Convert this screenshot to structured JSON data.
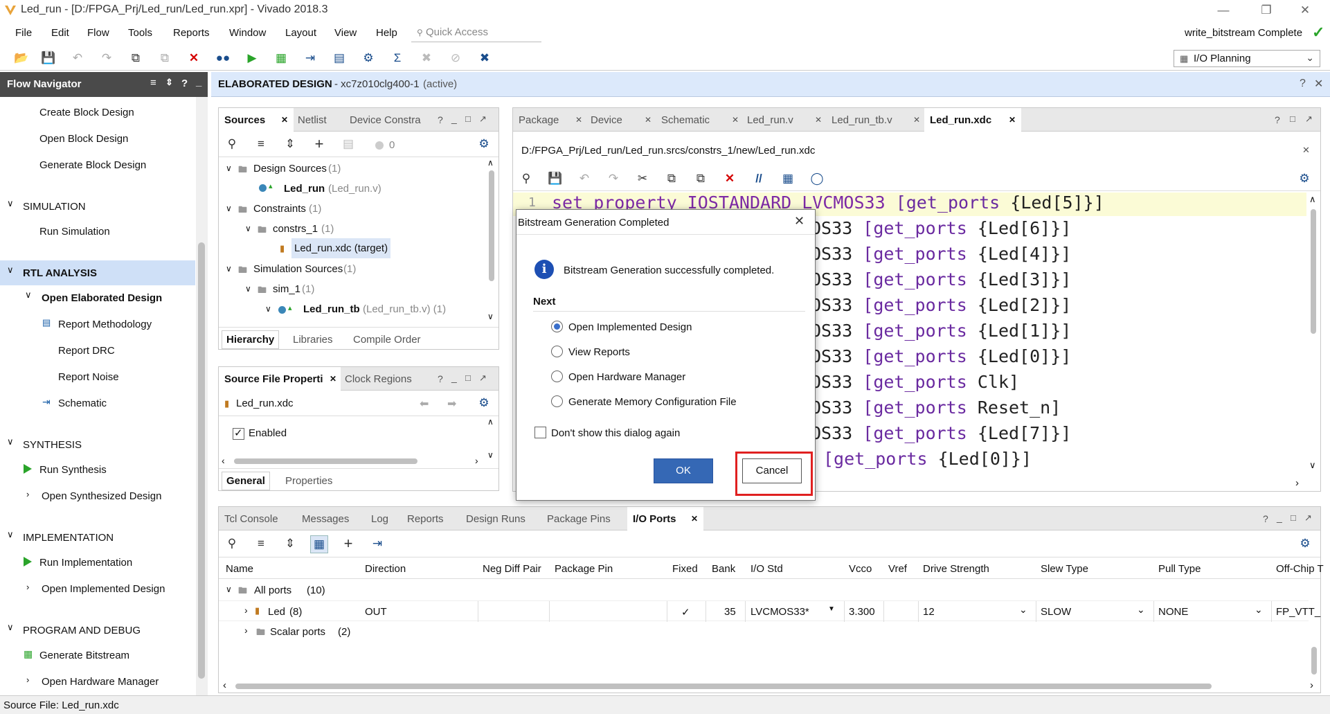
{
  "window": {
    "title": "Led_run - [D:/FPGA_Prj/Led_run/Led_run.xpr] - Vivado 2018.3",
    "status_right": "write_bitstream Complete"
  },
  "menu": [
    "File",
    "Edit",
    "Flow",
    "Tools",
    "Reports",
    "Window",
    "Layout",
    "View",
    "Help"
  ],
  "quick_access": {
    "placeholder": "Quick Access"
  },
  "layout_selector": {
    "value": "I/O Planning"
  },
  "flow_navigator": {
    "title": "Flow Navigator",
    "items": {
      "create_block": "Create Block Design",
      "open_block": "Open Block Design",
      "gen_block": "Generate Block Design",
      "simulation": "SIMULATION",
      "run_sim": "Run Simulation",
      "rtl": "RTL ANALYSIS",
      "open_elab": "Open Elaborated Design",
      "report_meth": "Report Methodology",
      "report_drc": "Report DRC",
      "report_noise": "Report Noise",
      "schematic": "Schematic",
      "synthesis": "SYNTHESIS",
      "run_synth": "Run Synthesis",
      "open_synth": "Open Synthesized Design",
      "implementation": "IMPLEMENTATION",
      "run_impl": "Run Implementation",
      "open_impl": "Open Implemented Design",
      "prog": "PROGRAM AND DEBUG",
      "gen_bit": "Generate Bitstream",
      "open_hw": "Open Hardware Manager"
    }
  },
  "design_header": {
    "title": "ELABORATED DESIGN",
    "part": "- xc7z010clg400-1",
    "state": "(active)"
  },
  "sources": {
    "tabs": [
      "Sources",
      "Netlist",
      "Device Constra"
    ],
    "count": "0",
    "tree": {
      "design_sources": "Design Sources",
      "design_sources_n": "(1)",
      "led_run": "Led_run",
      "led_run_file": "(Led_run.v)",
      "constraints": "Constraints",
      "constraints_n": "(1)",
      "constrs": "constrs_1",
      "constrs_n": "(1)",
      "xdc": "Led_run.xdc (target)",
      "sim_sources": "Simulation Sources",
      "sim_sources_n": "(1)",
      "sim1": "sim_1",
      "sim1_n": "(1)",
      "tb": "Led_run_tb",
      "tb_file": "(Led_run_tb.v) (1)"
    },
    "bottom_tabs": [
      "Hierarchy",
      "Libraries",
      "Compile Order"
    ]
  },
  "props": {
    "tabs": [
      "Source File Properti",
      "Clock Regions"
    ],
    "file": "Led_run.xdc",
    "enabled": "Enabled",
    "bottom_tabs": [
      "General",
      "Properties"
    ]
  },
  "editor": {
    "tabs": [
      "Package",
      "Device",
      "Schematic",
      "Led_run.v",
      "Led_run_tb.v",
      "Led_run.xdc"
    ],
    "path": "D:/FPGA_Prj/Led_run/Led_run.srcs/constrs_1/new/Led_run.xdc",
    "line1_num": "1",
    "line1": {
      "a": "set_property IOSTANDARD LVCMOS33 ",
      "b": "[get_ports ",
      "c": "{Led[5]}]"
    },
    "lines": [
      {
        "a": "OS33 ",
        "b": "[get_ports ",
        "c": "{Led[6]}]"
      },
      {
        "a": "OS33 ",
        "b": "[get_ports ",
        "c": "{Led[4]}]"
      },
      {
        "a": "OS33 ",
        "b": "[get_ports ",
        "c": "{Led[3]}]"
      },
      {
        "a": "OS33 ",
        "b": "[get_ports ",
        "c": "{Led[2]}]"
      },
      {
        "a": "OS33 ",
        "b": "[get_ports ",
        "c": "{Led[1]}]"
      },
      {
        "a": "OS33 ",
        "b": "[get_ports ",
        "c": "{Led[0]}]"
      },
      {
        "a": "OS33 ",
        "b": "[get_ports ",
        "c": "Clk]"
      },
      {
        "a": "OS33 ",
        "b": "[get_ports ",
        "c": "Reset_n]"
      },
      {
        "a": "OS33 ",
        "b": "[get_ports ",
        "c": "{Led[7]}]"
      }
    ],
    "last_line": {
      "b": "[get_ports ",
      "c": "{Led[0]}]"
    }
  },
  "dialog": {
    "title": "Bitstream Generation Completed",
    "message": "Bitstream Generation successfully completed.",
    "next": "Next",
    "options": [
      "Open Implemented Design",
      "View Reports",
      "Open Hardware Manager",
      "Generate Memory Configuration File"
    ],
    "dont_show": "Don't show this dialog again",
    "ok": "OK",
    "cancel": "Cancel"
  },
  "bottom": {
    "tabs": [
      "Tcl Console",
      "Messages",
      "Log",
      "Reports",
      "Design Runs",
      "Package Pins",
      "I/O Ports"
    ],
    "columns": [
      "Name",
      "Direction",
      "Neg Diff Pair",
      "Package Pin",
      "Fixed",
      "Bank",
      "I/O Std",
      "Vcco",
      "Vref",
      "Drive Strength",
      "Slew Type",
      "Pull Type",
      "Off-Chip T"
    ],
    "rows": {
      "all_ports": "All ports",
      "all_ports_n": "(10)",
      "led": "Led",
      "led_n": "(8)",
      "led_dir": "OUT",
      "led_fixed": "✓",
      "led_bank": "35",
      "led_iostd": "LVCMOS33*",
      "led_vcco": "3.300",
      "led_drive": "12",
      "led_slew": "SLOW",
      "led_pull": "NONE",
      "led_offchip": "FP_VTT_",
      "scalar": "Scalar ports",
      "scalar_n": "(2)"
    }
  },
  "status_bar": "Source File: Led_run.xdc",
  "colors": {
    "accent": "#3a6fcb",
    "highlight_box": "#e02020",
    "header_blue": "#dce9fb",
    "keyword": "#7d2aa6"
  }
}
